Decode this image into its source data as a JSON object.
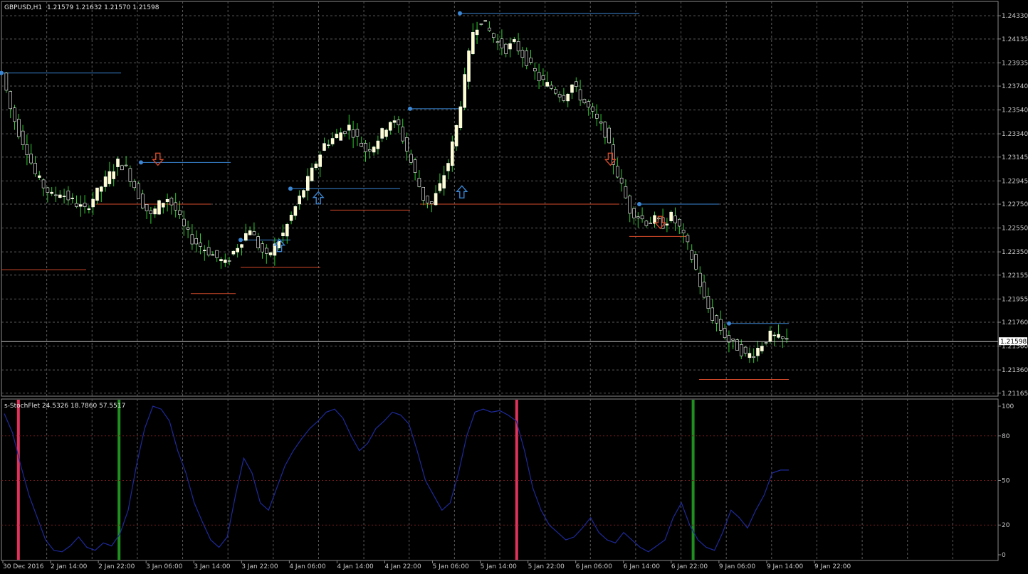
{
  "header": {
    "symbol": "GBPUSD,H1",
    "ohlc": "1.21579 1.21632 1.21570 1.21598"
  },
  "indicator": {
    "header": "s-StochFlet 24.5326 18.7860 57.5517"
  },
  "colors": {
    "background": "#000000",
    "grid": "#5a5a5a",
    "bull": "#ffffcc",
    "bear": "#ffffff",
    "wick": "#2ecc2e",
    "blueLine": "#3a86d4",
    "redLine": "#d44a2a",
    "stoch": "#1e2a9a",
    "signalRed": "#e0325a",
    "signalGreen": "#1f8f1f"
  },
  "chart_data": [
    {
      "type": "candlestick",
      "title": "GBPUSD,H1",
      "y_ticks": [
        "1.24330",
        "1.24135",
        "1.23935",
        "1.23740",
        "1.23540",
        "1.23340",
        "1.23145",
        "1.22945",
        "1.22750",
        "1.22550",
        "1.22350",
        "1.22155",
        "1.21955",
        "1.21760",
        "1.21560",
        "1.21360",
        "1.21165"
      ],
      "x_ticks": [
        "30 Dec 2016",
        "2 Jan 14:00",
        "2 Jan 22:00",
        "3 Jan 06:00",
        "3 Jan 14:00",
        "3 Jan 22:00",
        "4 Jan 06:00",
        "4 Jan 14:00",
        "4 Jan 22:00",
        "5 Jan 06:00",
        "5 Jan 14:00",
        "5 Jan 22:00",
        "6 Jan 06:00",
        "6 Jan 14:00",
        "6 Jan 22:00",
        "9 Jan 06:00",
        "9 Jan 14:00",
        "9 Jan 22:00"
      ],
      "ylim": [
        1.2114,
        1.2445
      ],
      "current_price": "1.21598",
      "close_path": [
        1.2385,
        1.2355,
        1.2335,
        1.232,
        1.23,
        1.229,
        1.2282,
        1.2285,
        1.228,
        1.2275,
        1.227,
        1.228,
        1.229,
        1.23,
        1.231,
        1.2305,
        1.229,
        1.2275,
        1.2265,
        1.2275,
        1.228,
        1.227,
        1.2255,
        1.2245,
        1.224,
        1.2235,
        1.223,
        1.2225,
        1.2235,
        1.2245,
        1.2255,
        1.224,
        1.223,
        1.224,
        1.225,
        1.2265,
        1.228,
        1.2295,
        1.231,
        1.2325,
        1.233,
        1.2335,
        1.234,
        1.233,
        1.232,
        1.2325,
        1.2335,
        1.2345,
        1.234,
        1.232,
        1.23,
        1.228,
        1.2275,
        1.229,
        1.231,
        1.234,
        1.238,
        1.242,
        1.243,
        1.242,
        1.241,
        1.2405,
        1.241,
        1.24,
        1.239,
        1.238,
        1.2375,
        1.237,
        1.2365,
        1.2375,
        1.2365,
        1.2355,
        1.2345,
        1.2335,
        1.231,
        1.229,
        1.227,
        1.2265,
        1.226,
        1.2262,
        1.2258,
        1.2265,
        1.2255,
        1.224,
        1.222,
        1.2195,
        1.218,
        1.217,
        1.216,
        1.2155,
        1.2148,
        1.215,
        1.2158,
        1.2165,
        1.2162,
        1.216
      ],
      "levels": {
        "blue": [
          {
            "y": 1.2385,
            "from": 0.0,
            "to": 0.12
          },
          {
            "y": 1.231,
            "from": 0.14,
            "to": 0.23
          },
          {
            "y": 1.2355,
            "from": 0.41,
            "to": 0.46
          },
          {
            "y": 1.2288,
            "from": 0.29,
            "to": 0.4
          },
          {
            "y": 1.2245,
            "from": 0.24,
            "to": 0.29
          },
          {
            "y": 1.2435,
            "from": 0.46,
            "to": 0.64
          },
          {
            "y": 1.2275,
            "from": 0.64,
            "to": 0.72
          },
          {
            "y": 1.2175,
            "from": 0.73,
            "to": 0.79
          }
        ],
        "red": [
          {
            "y": 1.222,
            "from": 0.0,
            "to": 0.085
          },
          {
            "y": 1.2275,
            "from": 0.095,
            "to": 0.21
          },
          {
            "y": 1.22,
            "from": 0.19,
            "to": 0.235
          },
          {
            "y": 1.2222,
            "from": 0.24,
            "to": 0.32
          },
          {
            "y": 1.227,
            "from": 0.33,
            "to": 0.41
          },
          {
            "y": 1.2275,
            "from": 0.42,
            "to": 0.62
          },
          {
            "y": 1.2248,
            "from": 0.63,
            "to": 0.69
          },
          {
            "y": 1.2128,
            "from": 0.7,
            "to": 0.79
          }
        ]
      },
      "arrows": [
        {
          "dir": "down",
          "x": 0.157,
          "y": 1.2313
        },
        {
          "dir": "up",
          "x": 0.279,
          "y": 1.224
        },
        {
          "dir": "up",
          "x": 0.318,
          "y": 1.228
        },
        {
          "dir": "up",
          "x": 0.462,
          "y": 1.2285
        },
        {
          "dir": "down",
          "x": 0.611,
          "y": 1.2313
        },
        {
          "dir": "down",
          "x": 0.661,
          "y": 1.226
        }
      ]
    },
    {
      "type": "line",
      "title": "s-StochFlet",
      "y_ticks": [
        "100",
        "80",
        "50",
        "20",
        "0"
      ],
      "ylim": [
        0,
        100
      ],
      "levels": [
        80,
        50,
        20
      ],
      "values": [
        95,
        82,
        60,
        40,
        25,
        10,
        3,
        2,
        6,
        12,
        5,
        3,
        8,
        6,
        14,
        30,
        60,
        85,
        100,
        98,
        90,
        70,
        55,
        35,
        22,
        10,
        5,
        12,
        40,
        65,
        55,
        35,
        30,
        45,
        60,
        70,
        78,
        85,
        90,
        96,
        98,
        92,
        80,
        70,
        75,
        85,
        90,
        96,
        94,
        88,
        70,
        50,
        40,
        30,
        35,
        55,
        80,
        96,
        98,
        96,
        97,
        94,
        90,
        70,
        45,
        30,
        20,
        15,
        10,
        12,
        18,
        25,
        15,
        10,
        8,
        15,
        10,
        5,
        2,
        6,
        10,
        25,
        35,
        20,
        10,
        5,
        3,
        15,
        30,
        25,
        18,
        30,
        40,
        55,
        57,
        57
      ],
      "signals": [
        {
          "color": "red",
          "x": 0.017
        },
        {
          "color": "green",
          "x": 0.118
        },
        {
          "color": "red",
          "x": 0.517
        },
        {
          "color": "green",
          "x": 0.694
        }
      ]
    }
  ]
}
